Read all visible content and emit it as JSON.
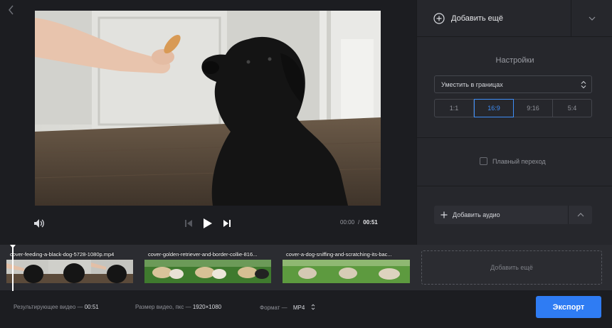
{
  "player": {
    "time_current": "00:00",
    "time_sep": "/",
    "time_total": "00:51"
  },
  "panel": {
    "add_more_label": "Добавить ещё",
    "settings_title": "Настройки",
    "fit_mode": "Уместить в границах",
    "ratios": [
      {
        "label": "1:1",
        "active": false
      },
      {
        "label": "16:9",
        "active": true
      },
      {
        "label": "9:16",
        "active": false
      },
      {
        "label": "5:4",
        "active": false
      }
    ],
    "smooth_transition_label": "Плавный переход",
    "smooth_transition_checked": false,
    "add_audio_label": "Добавить аудио"
  },
  "timeline": {
    "clips": [
      {
        "name": "cover-feeding-a-black-dog-5728-1080p.mp4"
      },
      {
        "name": "cover-golden-retriever-and-border-collie-816..."
      },
      {
        "name": "cover-a-dog-sniffing-and-scratching-its-bac..."
      }
    ],
    "add_more_label": "Добавить ещё"
  },
  "footer": {
    "result_label": "Результирующее видео —",
    "result_value": "00:51",
    "size_label": "Размер видео, пкс —",
    "size_value": "1920×1080",
    "format_label": "Формат —",
    "format_value": "MP4",
    "export_label": "Экспорт"
  },
  "colors": {
    "accent": "#2f7cf3",
    "active_ratio": "#3e8ef7",
    "background": "#1c1d21",
    "panel": "#26272c"
  }
}
